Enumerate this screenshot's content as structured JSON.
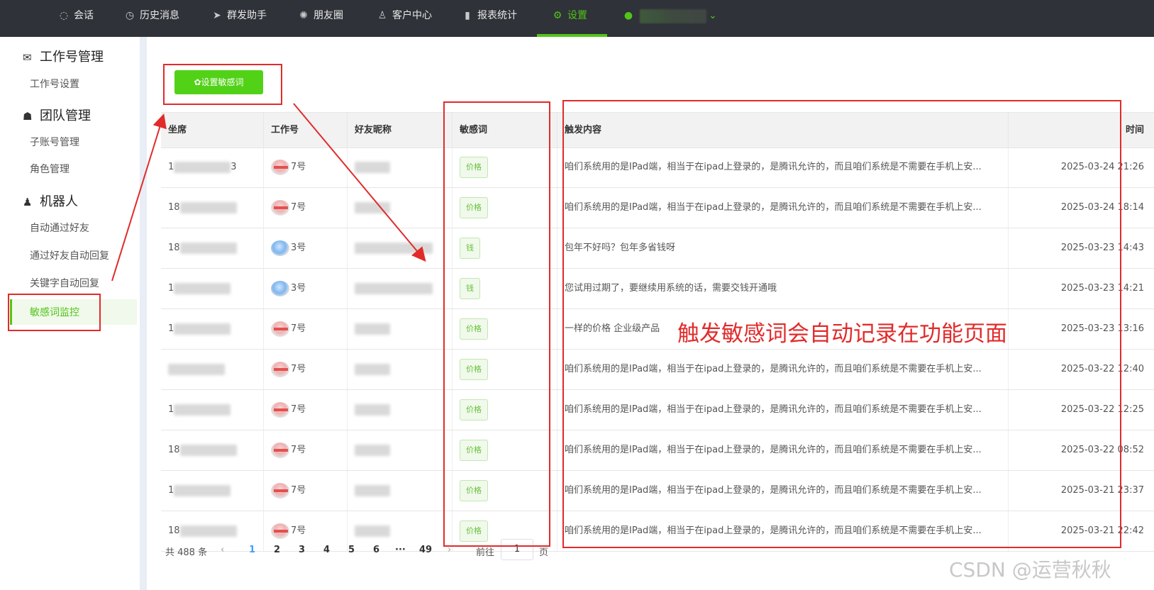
{
  "topnav": {
    "items": [
      {
        "label": "会话",
        "icon": "chat-icon"
      },
      {
        "label": "历史消息",
        "icon": "clock-icon"
      },
      {
        "label": "群发助手",
        "icon": "send-icon"
      },
      {
        "label": "朋友圈",
        "icon": "aperture-icon"
      },
      {
        "label": "客户中心",
        "icon": "person-icon"
      },
      {
        "label": "报表统计",
        "icon": "bar-chart-icon"
      },
      {
        "label": "设置",
        "icon": "gear-icon"
      }
    ],
    "active": "设置"
  },
  "sidebar": {
    "groups": [
      {
        "label": "工作号管理",
        "icon": "wechat-icon",
        "items": [
          "工作号设置"
        ]
      },
      {
        "label": "团队管理",
        "icon": "team-icon",
        "items": [
          "子账号管理",
          "角色管理"
        ]
      },
      {
        "label": "机器人",
        "icon": "robot-icon",
        "items": [
          "自动通过好友",
          "通过好友自动回复",
          "关键字自动回复",
          "敏感词监控"
        ]
      }
    ],
    "active_item": "敏感词监控"
  },
  "toolbar": {
    "set_sensitive_button": "✿设置敏感词"
  },
  "table": {
    "headers": [
      "坐席",
      "工作号",
      "好友昵称",
      "敏感词",
      "触发内容",
      "时间"
    ],
    "rows": [
      {
        "seat_prefix": "1",
        "seat_suffix": "3",
        "work_no": "7号",
        "avatar": "red",
        "nick_prefix": "",
        "word": "价格",
        "content": "咱们系统用的是IPad端，相当于在ipad上登录的，是腾讯允许的，而且咱们系统是不需要在手机上安...",
        "time": "2025-03-24 21:26"
      },
      {
        "seat_prefix": "18",
        "seat_suffix": "",
        "work_no": "7号",
        "avatar": "red",
        "nick_prefix": "",
        "word": "价格",
        "content": "咱们系统用的是IPad端，相当于在ipad上登录的，是腾讯允许的，而且咱们系统是不需要在手机上安...",
        "time": "2025-03-24 18:14"
      },
      {
        "seat_prefix": "18",
        "seat_suffix": "",
        "work_no": "3号",
        "avatar": "blue",
        "nick_prefix": "",
        "word": "钱",
        "content": "包年不好吗？包年多省钱呀",
        "time": "2025-03-23 14:43"
      },
      {
        "seat_prefix": "1",
        "seat_suffix": "",
        "work_no": "3号",
        "avatar": "blue",
        "nick_prefix": "",
        "word": "钱",
        "content": "您试用过期了，要继续用系统的话，需要交钱开通哦",
        "time": "2025-03-23 14:21"
      },
      {
        "seat_prefix": "1",
        "seat_suffix": "",
        "work_no": "7号",
        "avatar": "red",
        "nick_prefix": "",
        "word": "价格",
        "content": "一样的价格 企业级产品",
        "time": "2025-03-23 13:16"
      },
      {
        "seat_prefix": "",
        "seat_suffix": "",
        "work_no": "7号",
        "avatar": "red",
        "nick_prefix": "",
        "word": "价格",
        "content": "咱们系统用的是IPad端，相当于在ipad上登录的，是腾讯允许的，而且咱们系统是不需要在手机上安...",
        "time": "2025-03-22 12:40"
      },
      {
        "seat_prefix": "1",
        "seat_suffix": "",
        "work_no": "7号",
        "avatar": "red",
        "nick_prefix": "",
        "word": "价格",
        "content": "咱们系统用的是IPad端，相当于在ipad上登录的，是腾讯允许的，而且咱们系统是不需要在手机上安...",
        "time": "2025-03-22 12:25"
      },
      {
        "seat_prefix": "18",
        "seat_suffix": "",
        "work_no": "7号",
        "avatar": "red",
        "nick_prefix": "",
        "word": "价格",
        "content": "咱们系统用的是IPad端，相当于在ipad上登录的，是腾讯允许的，而且咱们系统是不需要在手机上安...",
        "time": "2025-03-22 08:52"
      },
      {
        "seat_prefix": "1",
        "seat_suffix": "",
        "work_no": "7号",
        "avatar": "red",
        "nick_prefix": "",
        "word": "价格",
        "content": "咱们系统用的是IPad端，相当于在ipad上登录的，是腾讯允许的，而且咱们系统是不需要在手机上安...",
        "time": "2025-03-21 23:37"
      },
      {
        "seat_prefix": "18",
        "seat_suffix": "",
        "work_no": "7号",
        "avatar": "red",
        "nick_prefix": "",
        "word": "价格",
        "content": "咱们系统用的是IPad端，相当于在ipad上登录的，是腾讯允许的，而且咱们系统是不需要在手机上安...",
        "time": "2025-03-21 22:42"
      }
    ]
  },
  "pagination": {
    "total": "共 488 条",
    "prev": "‹",
    "pages": [
      "1",
      "2",
      "3",
      "4",
      "5",
      "6",
      "···",
      "49"
    ],
    "current": "1",
    "next": "›",
    "goto_label": "前往",
    "goto_value": "1",
    "page_unit": "页"
  },
  "annotation": {
    "text": "触发敏感词会自动记录在功能页面",
    "color": "#e12b2b"
  },
  "watermark": "CSDN @运营秋秋",
  "colors": {
    "accent": "#52c41a",
    "nav_bg": "#2f3238",
    "annotation_red": "#e12b2b"
  }
}
